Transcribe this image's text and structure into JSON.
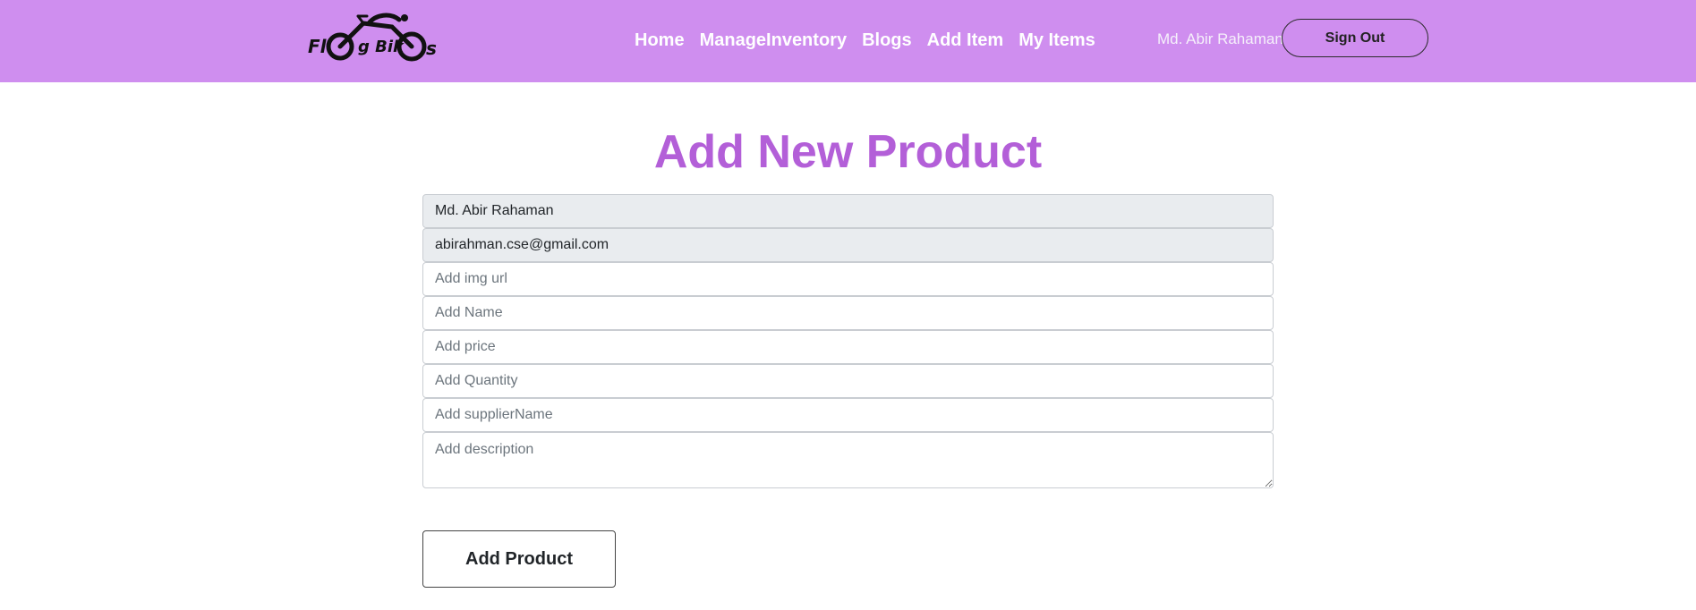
{
  "brand": {
    "logo_text": "FlagBikes",
    "logo_part1": "Fl",
    "logo_part2": "g Bik",
    "logo_part3": "s"
  },
  "nav": {
    "links": [
      {
        "label": "Home"
      },
      {
        "label": "ManageInventory"
      },
      {
        "label": "Blogs"
      },
      {
        "label": "Add Item"
      },
      {
        "label": "My Items"
      }
    ],
    "user_name": "Md. Abir Rahaman",
    "signout_label": "Sign Out"
  },
  "main": {
    "title": "Add New Product",
    "fields": {
      "user_name": {
        "value": "Md. Abir Rahaman"
      },
      "email": {
        "value": "abirahman.cse@gmail.com"
      },
      "img_url": {
        "placeholder": "Add img url"
      },
      "name": {
        "placeholder": "Add Name"
      },
      "price": {
        "placeholder": "Add price"
      },
      "quantity": {
        "placeholder": "Add Quantity"
      },
      "supplier": {
        "placeholder": "Add supplierName"
      },
      "description": {
        "placeholder": "Add description"
      }
    },
    "submit_label": "Add Product"
  },
  "colors": {
    "navbar": "#cf8eef",
    "title": "#b35fd8"
  },
  "icons": [
    "bike-logo-icon"
  ]
}
